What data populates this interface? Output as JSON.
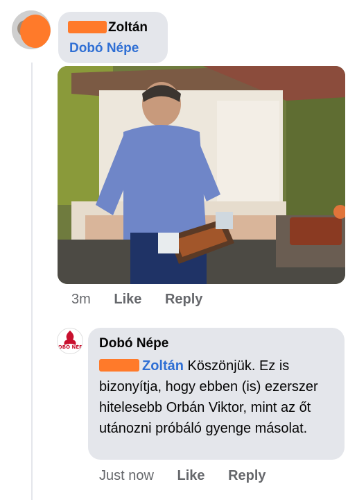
{
  "comment": {
    "author_visible_name": "Zoltán",
    "mention": "Dobó Népe",
    "time": "3m",
    "like_label": "Like",
    "reply_label": "Reply"
  },
  "reply": {
    "author": "Dobó Népe",
    "avatar_text": "DOBÓ NÉPE",
    "mention": "Zoltán",
    "text": " Köszönjük. Ez is bizonyítja, hogy ebben (is) ezerszer hitelesebb Orbán Viktor, mint az őt utánozni próbáló gyenge másolat.",
    "time": "Just now",
    "like_label": "Like",
    "reply_label": "Reply"
  },
  "colors": {
    "bubble": "#e4e6eb",
    "link": "#2f6fd4",
    "meta": "#65676b",
    "redaction": "#ff7a2a"
  }
}
